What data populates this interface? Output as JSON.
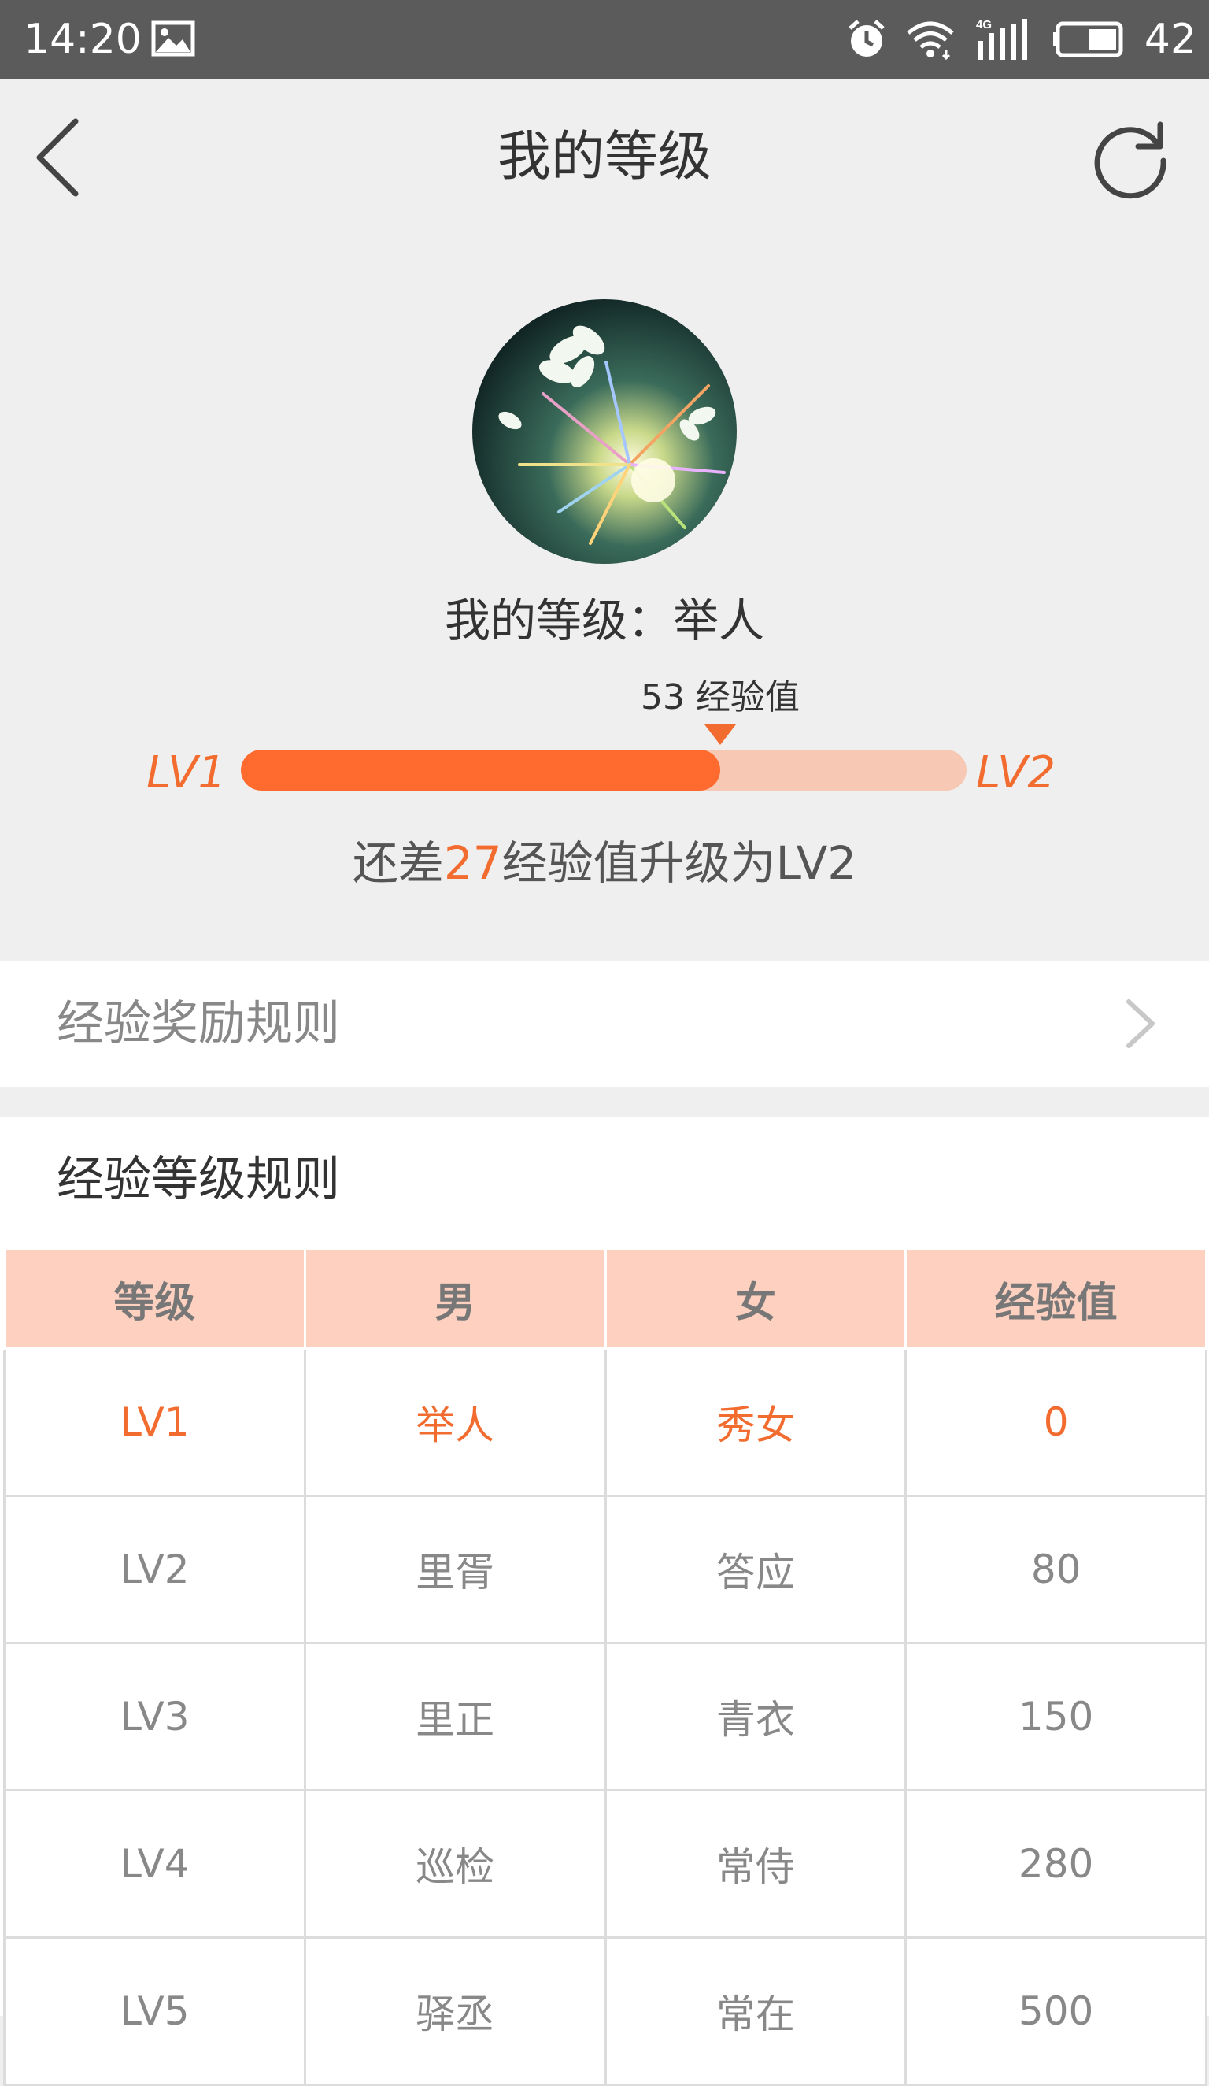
{
  "status_bar": {
    "time": "14:20",
    "network": "4G",
    "battery": "42"
  },
  "nav": {
    "title": "我的等级"
  },
  "profile": {
    "level_label": "我的等级：",
    "level_name": "举人",
    "exp_label": "53 经验值",
    "exp_current": 53,
    "exp_next_threshold": 80,
    "progress_fraction": 0.66,
    "current_level": "LV1",
    "next_level": "LV2",
    "remaining_prefix": "还差",
    "remaining_value": "27",
    "remaining_suffix": "经验值升级为LV2"
  },
  "rewards": {
    "label": "经验奖励规则"
  },
  "rules": {
    "title": "经验等级规则",
    "headers": [
      "等级",
      "男",
      "女",
      "经验值"
    ],
    "rows": [
      [
        "LV1",
        "举人",
        "秀女",
        "0"
      ],
      [
        "LV2",
        "里胥",
        "答应",
        "80"
      ],
      [
        "LV3",
        "里正",
        "青衣",
        "150"
      ],
      [
        "LV4",
        "巡检",
        "常侍",
        "280"
      ],
      [
        "LV5",
        "驿丞",
        "常在",
        "500"
      ]
    ]
  },
  "colors": {
    "accent": "#f26b2f",
    "progress_fill": "#ff6a2f",
    "progress_track": "#f7c9b4",
    "table_header_bg": "#fdd0bf",
    "status_bar_bg": "#5b5b5b"
  }
}
